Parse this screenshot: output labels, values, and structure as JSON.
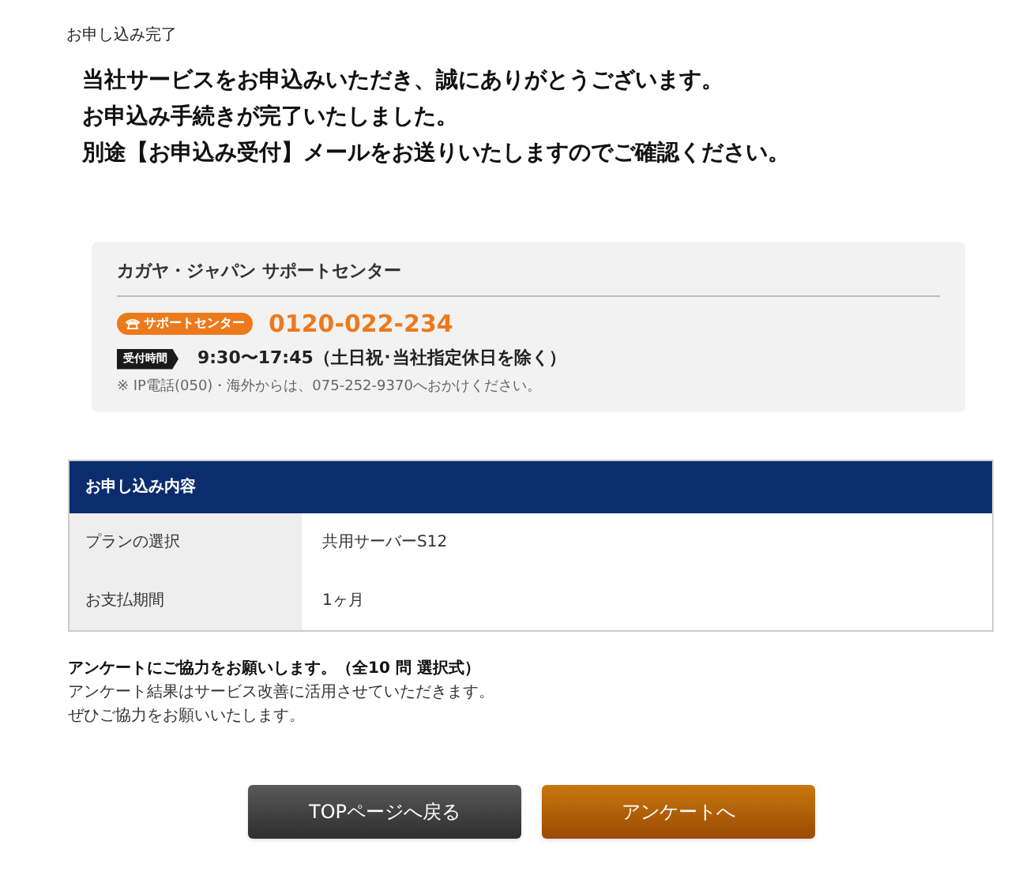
{
  "page_title": "お申し込み完了",
  "message_lines": [
    "当社サービスをお申込みいただき、誠にありがとうございます。",
    "お申込み手続きが完了いたしました。",
    "別途【お申込み受付】メールをお送りいたしますのでご確認ください。"
  ],
  "support": {
    "title": "カガヤ・ジャパン サポートセンター",
    "badge": "サポートセンター",
    "phone": "0120-022-234",
    "hours_tag": "受付時間",
    "hours": "9:30〜17:45（土日祝･当社指定休日を除く）",
    "note": "※ IP電話(050)・海外からは、075-252-9370へおかけください。"
  },
  "order": {
    "heading": "お申し込み内容",
    "rows": [
      {
        "label": "プランの選択",
        "value": "共用サーバーS12"
      },
      {
        "label": "お支払期間",
        "value": "1ヶ月"
      }
    ]
  },
  "survey": {
    "title": "アンケートにご協力をお願いします。（全10 問 選択式）",
    "lines": [
      "アンケート結果はサービス改善に活用させていただきます。",
      "ぜひご協力をお願いいたします。"
    ]
  },
  "buttons": [
    {
      "label": "TOPページへ戻る",
      "kind": "secondary"
    },
    {
      "label": "アンケートへ",
      "kind": "primary"
    }
  ]
}
